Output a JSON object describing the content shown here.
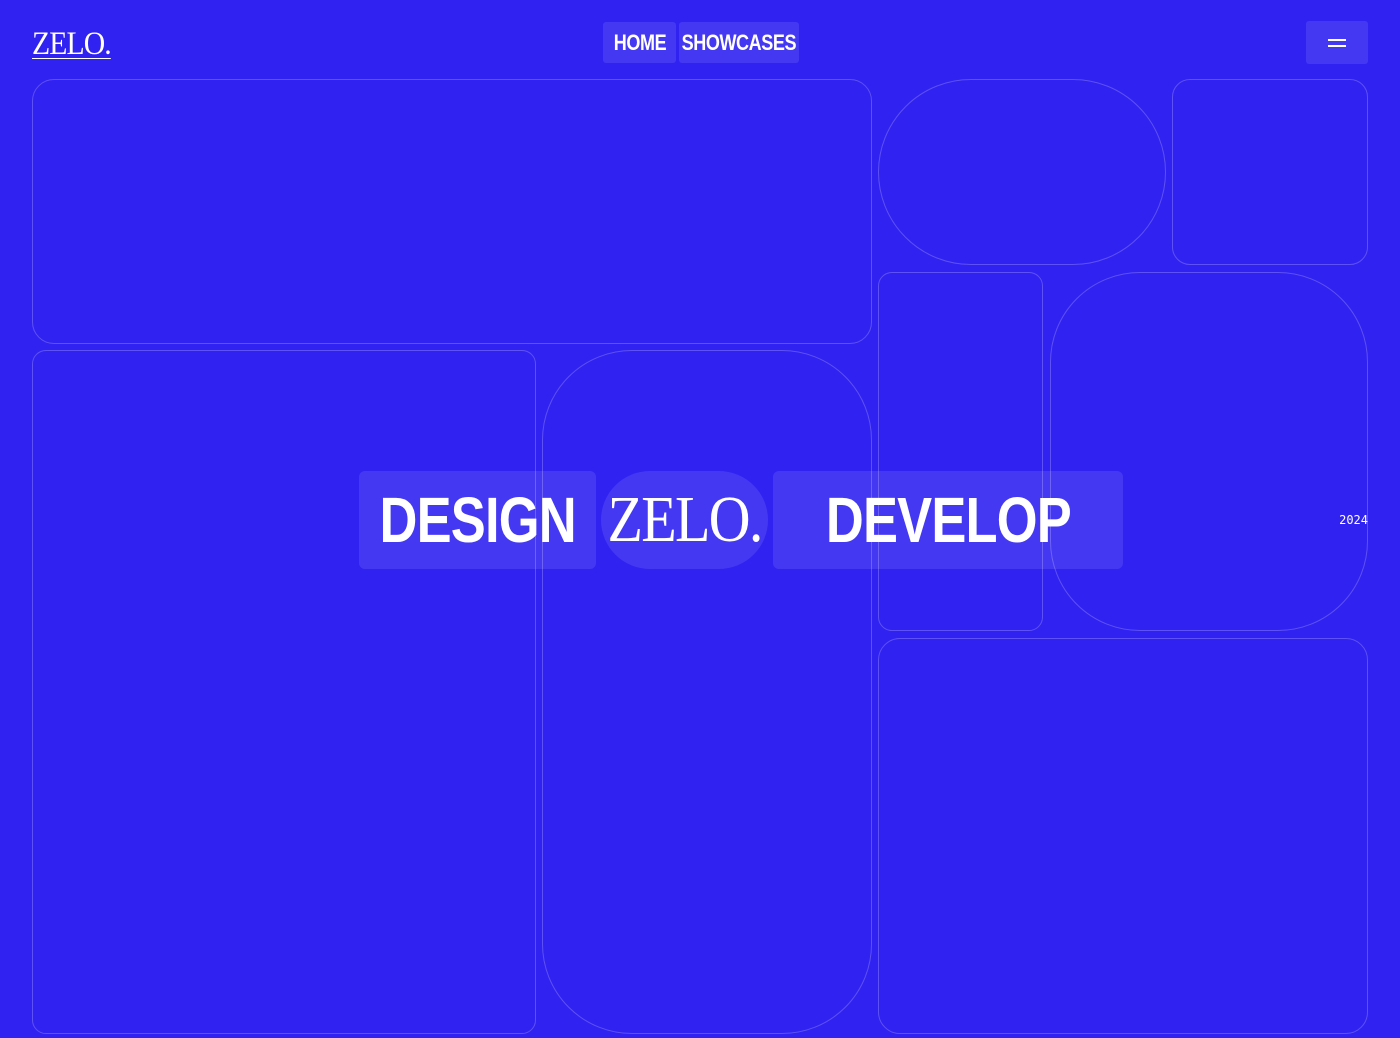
{
  "header": {
    "logo": "ZELO.",
    "nav": [
      {
        "label": "HOME"
      },
      {
        "label": "SHOWCASES"
      }
    ],
    "menu_icon": "hamburger-icon"
  },
  "hero": {
    "word_left": "DESIGN",
    "logo": "ZELO.",
    "word_right": "DEVELOP",
    "year": "2024"
  },
  "colors": {
    "background": "#3022F1",
    "text": "#FFFFFF",
    "tile_border": "rgba(255,255,255,0.22)",
    "pill_fill": "rgba(255,255,255,0.10)"
  }
}
